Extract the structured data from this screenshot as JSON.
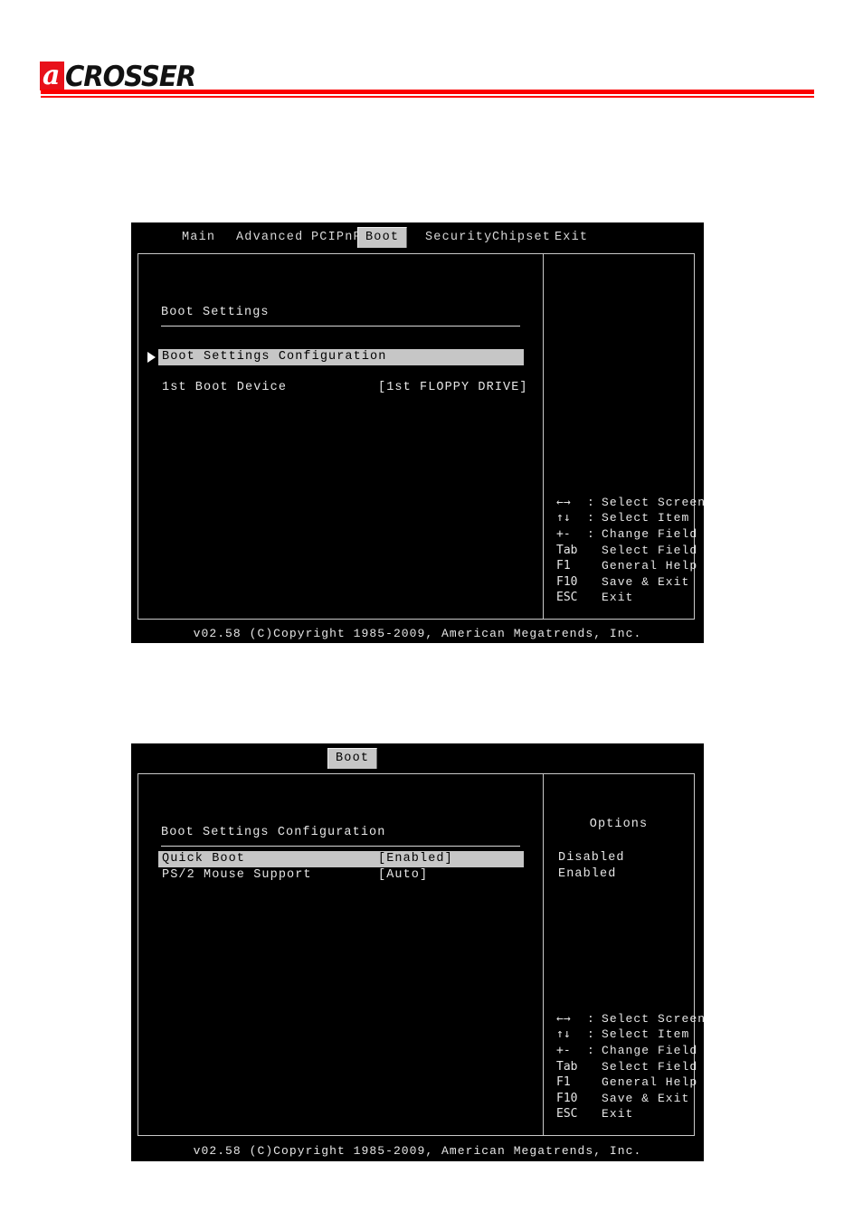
{
  "brand": {
    "logo_mark_letter": "a",
    "logo_word": "CROSSER",
    "accent_color": "#fb0000",
    "mark_color": "#e8111a"
  },
  "screens": [
    {
      "id": "boot-settings",
      "menu_tabs": [
        {
          "label": "Main",
          "active": false
        },
        {
          "label": "Advanced",
          "active": false
        },
        {
          "label": "PCIPnP",
          "active": false
        },
        {
          "label": "Boot",
          "active": true
        },
        {
          "label": "Security",
          "active": false
        },
        {
          "label": "Chipset",
          "active": false
        },
        {
          "label": "Exit",
          "active": false
        }
      ],
      "section_title": "Boot Settings",
      "rows": [
        {
          "label": "Boot Settings Configuration",
          "value": "",
          "highlight": true,
          "caret": true
        },
        {
          "label": "1st Boot Device",
          "value": "[1st FLOPPY DRIVE]",
          "highlight": false,
          "caret": false
        }
      ],
      "options_title": "",
      "options_items": [],
      "keys": [
        {
          "sym": "←→",
          "sep": ":",
          "text": "Select Screen"
        },
        {
          "sym": "↑↓",
          "sep": ":",
          "text": "Select Item"
        },
        {
          "sym": "+-",
          "sep": ":",
          "text": "Change Field"
        },
        {
          "sym": "Tab",
          "sep": "",
          "text": "Select Field"
        },
        {
          "sym": "F1",
          "sep": "",
          "text": "General Help"
        },
        {
          "sym": "F10",
          "sep": "",
          "text": "Save & Exit"
        },
        {
          "sym": "ESC",
          "sep": "",
          "text": "Exit"
        }
      ],
      "footer": "v02.58 (C)Copyright 1985-2009, American Megatrends, Inc."
    },
    {
      "id": "boot-settings-configuration",
      "menu_tabs": [
        {
          "label": "Boot",
          "active": true
        }
      ],
      "section_title": "Boot Settings Configuration",
      "rows": [
        {
          "label": "Quick Boot",
          "value": "[Enabled]",
          "highlight": true,
          "caret": false
        },
        {
          "label": "PS/2 Mouse Support",
          "value": "[Auto]",
          "highlight": false,
          "caret": false
        }
      ],
      "options_title": "Options",
      "options_items": [
        "Disabled",
        "Enabled"
      ],
      "keys": [
        {
          "sym": "←→",
          "sep": ":",
          "text": "Select Screen"
        },
        {
          "sym": "↑↓",
          "sep": ":",
          "text": "Select Item"
        },
        {
          "sym": "+-",
          "sep": ":",
          "text": "Change Field"
        },
        {
          "sym": "Tab",
          "sep": "",
          "text": "Select Field"
        },
        {
          "sym": "F1",
          "sep": "",
          "text": "General Help"
        },
        {
          "sym": "F10",
          "sep": "",
          "text": "Save & Exit"
        },
        {
          "sym": "ESC",
          "sep": "",
          "text": "Exit"
        }
      ],
      "footer": "v02.58 (C)Copyright 1985-2009, American Megatrends, Inc."
    }
  ]
}
